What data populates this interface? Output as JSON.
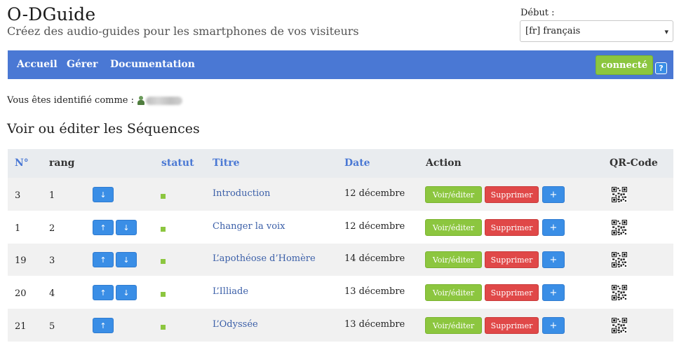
{
  "header": {
    "title": "O-DGuide",
    "subtitle": "Créez des audio-guides pour les smartphones de vos visiteurs",
    "lang_label": "Début :",
    "lang_value": "[fr] français"
  },
  "nav": {
    "items": [
      "Accueil",
      "Gérer",
      "Documentation"
    ],
    "connect_label": "connecté",
    "help_label": "?"
  },
  "identity": {
    "text": "Vous êtes identifié comme :"
  },
  "section": {
    "title": "Voir ou éditer les Séquences"
  },
  "table": {
    "headers": {
      "num": "N°",
      "rank": "rang",
      "status": "statut",
      "title": "Titre",
      "date": "Date",
      "action": "Action",
      "qr": "QR-Code"
    },
    "rows": [
      {
        "num": "3",
        "rank": "1",
        "title": "Introduction",
        "date": "12 décembre",
        "up": false,
        "down": true
      },
      {
        "num": "1",
        "rank": "2",
        "title": "Changer la voix",
        "date": "12 décembre",
        "up": true,
        "down": true
      },
      {
        "num": "19",
        "rank": "3",
        "title": "L’apothéose d’Homère",
        "date": "14 décembre",
        "up": true,
        "down": true
      },
      {
        "num": "20",
        "rank": "4",
        "title": "L’Illiade",
        "date": "13 décembre",
        "up": true,
        "down": true
      },
      {
        "num": "21",
        "rank": "5",
        "title": "L’Odyssée",
        "date": "13 décembre",
        "up": true,
        "down": false
      }
    ],
    "buttons": {
      "view": "Voir/éditer",
      "delete": "Supprimer",
      "plus": "+",
      "up": "↑",
      "down": "↓"
    }
  },
  "colors": {
    "nav_bg": "#4a78d4",
    "success": "#8cc63f",
    "danger": "#e04848",
    "primary": "#3a8ee6"
  }
}
